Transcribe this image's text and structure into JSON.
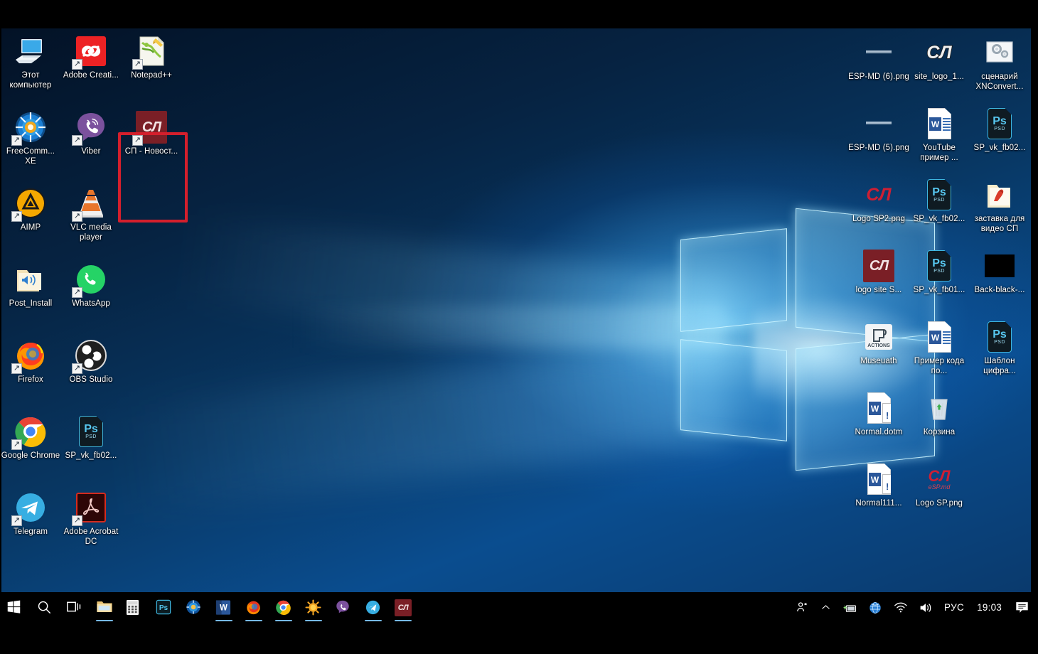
{
  "desktop": {
    "wallpaper_name": "windows-10-hero-blue",
    "accent_color": "#0a4d8f",
    "highlight_color": "#d41f2c",
    "left_icons": [
      {
        "label": "Этот компьютер",
        "icon": "this-pc-icon",
        "shortcut": false,
        "col": 0,
        "row": 0
      },
      {
        "label": "Adobe Creati...",
        "icon": "adobe-creative-cloud-icon",
        "shortcut": true,
        "col": 1,
        "row": 0
      },
      {
        "label": "Notepad++",
        "icon": "notepad-plus-plus-icon",
        "shortcut": true,
        "col": 2,
        "row": 0
      },
      {
        "label": "FreeComm... XE",
        "icon": "freecommander-xe-icon",
        "shortcut": true,
        "col": 0,
        "row": 1
      },
      {
        "label": "Viber",
        "icon": "viber-icon",
        "shortcut": true,
        "col": 1,
        "row": 1
      },
      {
        "label": "СП - Новост...",
        "icon": "sp-novosti-icon",
        "shortcut": true,
        "col": 2,
        "row": 1,
        "highlighted": true
      },
      {
        "label": "AIMP",
        "icon": "aimp-icon",
        "shortcut": true,
        "col": 0,
        "row": 2
      },
      {
        "label": "VLC media player",
        "icon": "vlc-media-player-icon",
        "shortcut": true,
        "col": 1,
        "row": 2
      },
      {
        "label": "Post_Install",
        "icon": "folder-shortcut-icon",
        "shortcut": false,
        "col": 0,
        "row": 3
      },
      {
        "label": "WhatsApp",
        "icon": "whatsapp-icon",
        "shortcut": true,
        "col": 1,
        "row": 3
      },
      {
        "label": "Firefox",
        "icon": "firefox-icon",
        "shortcut": true,
        "col": 0,
        "row": 4
      },
      {
        "label": "OBS Studio",
        "icon": "obs-studio-icon",
        "shortcut": true,
        "col": 1,
        "row": 4
      },
      {
        "label": "Google Chrome",
        "icon": "google-chrome-icon",
        "shortcut": true,
        "col": 0,
        "row": 5
      },
      {
        "label": "SP_vk_fb02...",
        "icon": "photoshop-psd-file-icon",
        "shortcut": false,
        "col": 1,
        "row": 5
      },
      {
        "label": "Telegram",
        "icon": "telegram-icon",
        "shortcut": true,
        "col": 0,
        "row": 6
      },
      {
        "label": "Adobe Acrobat DC",
        "icon": "adobe-acrobat-dc-icon",
        "shortcut": true,
        "col": 1,
        "row": 6
      }
    ],
    "right_icons": [
      {
        "label": "ESP-MD (6).png",
        "icon": "png-thumbnail-icon",
        "col": 0,
        "row": 0
      },
      {
        "label": "site_logo_1...",
        "icon": "sp-site-logo-icon",
        "col": 1,
        "row": 0
      },
      {
        "label": "сценарий XNConvert...",
        "icon": "xnconvert-script-icon",
        "col": 2,
        "row": 0
      },
      {
        "label": "ESP-MD (5).png",
        "icon": "png-thumbnail-icon",
        "col": 0,
        "row": 1
      },
      {
        "label": "YouTube пример ...",
        "icon": "word-document-icon",
        "col": 1,
        "row": 1
      },
      {
        "label": "SP_vk_fb02...",
        "icon": "photoshop-psd-file-icon",
        "col": 2,
        "row": 1
      },
      {
        "label": "Logo SP2.png",
        "icon": "sp-logo-red-png-icon",
        "col": 0,
        "row": 2
      },
      {
        "label": "SP_vk_fb02...",
        "icon": "photoshop-psd-file-icon",
        "col": 1,
        "row": 2
      },
      {
        "label": "заставка для видео СП",
        "icon": "folder-picture-icon",
        "col": 2,
        "row": 2
      },
      {
        "label": "logo site S...",
        "icon": "sp-logo-tile-icon",
        "col": 0,
        "row": 3
      },
      {
        "label": "SP_vk_fb01...",
        "icon": "photoshop-psd-file-icon",
        "col": 1,
        "row": 3
      },
      {
        "label": "Back-black-...",
        "icon": "black-image-icon",
        "col": 2,
        "row": 3
      },
      {
        "label": "Museuath",
        "icon": "actions-script-icon",
        "col": 0,
        "row": 4
      },
      {
        "label": "Пример кода по...",
        "icon": "word-document-icon",
        "col": 1,
        "row": 4
      },
      {
        "label": "Шаблон цифра...",
        "icon": "photoshop-psd-file-icon",
        "col": 2,
        "row": 4
      },
      {
        "label": "Normal.dotm",
        "icon": "word-template-icon",
        "col": 0,
        "row": 5
      },
      {
        "label": "Корзина",
        "icon": "recycle-bin-icon",
        "col": 1,
        "row": 5
      },
      {
        "label": "Normal111...",
        "icon": "word-template-icon",
        "col": 0,
        "row": 6
      },
      {
        "label": "Logo SP.png",
        "icon": "sp-logo-esp-md-icon",
        "col": 1,
        "row": 6
      }
    ]
  },
  "taskbar": {
    "buttons": [
      {
        "name": "start-button",
        "icon": "windows-logo-icon",
        "label": "Пуск",
        "running": false
      },
      {
        "name": "search-button",
        "icon": "search-icon",
        "label": "Поиск",
        "running": false
      },
      {
        "name": "task-view-button",
        "icon": "task-view-icon",
        "label": "Представление задач",
        "running": false
      },
      {
        "name": "file-explorer-button",
        "icon": "folder-icon",
        "label": "Проводник",
        "running": true
      },
      {
        "name": "calculator-button",
        "icon": "calculator-icon",
        "label": "Калькулятор",
        "running": false
      },
      {
        "name": "photoshop-button",
        "icon": "photoshop-icon",
        "label": "Photoshop",
        "running": false
      },
      {
        "name": "freecommander-button",
        "icon": "freecommander-xe-icon",
        "label": "FreeCommander XE",
        "running": false
      },
      {
        "name": "word-button",
        "icon": "word-icon",
        "label": "Word",
        "running": true
      },
      {
        "name": "firefox-button",
        "icon": "firefox-icon",
        "label": "Firefox",
        "running": true
      },
      {
        "name": "chrome-button",
        "icon": "google-chrome-icon",
        "label": "Google Chrome",
        "running": true
      },
      {
        "name": "sunny-app-button",
        "icon": "sun-app-icon",
        "label": "Приложение",
        "running": true
      },
      {
        "name": "viber-button",
        "icon": "viber-icon",
        "label": "Viber",
        "running": false
      },
      {
        "name": "telegram-button",
        "icon": "telegram-icon",
        "label": "Telegram",
        "running": true
      },
      {
        "name": "sp-browser-button",
        "icon": "sp-logo-tile-icon",
        "label": "СП",
        "running": true
      }
    ],
    "tray": {
      "people_label": "Люди",
      "show_hidden_label": "Отображать скрытые значки",
      "hardware_label": "Безопасное извлечение устройств",
      "network_label": "Сеть",
      "wifi_label": "Wi-Fi",
      "volume_label": "Динамики",
      "language": "РУС",
      "clock": "19:03",
      "action_center_label": "Центр уведомлений"
    }
  }
}
